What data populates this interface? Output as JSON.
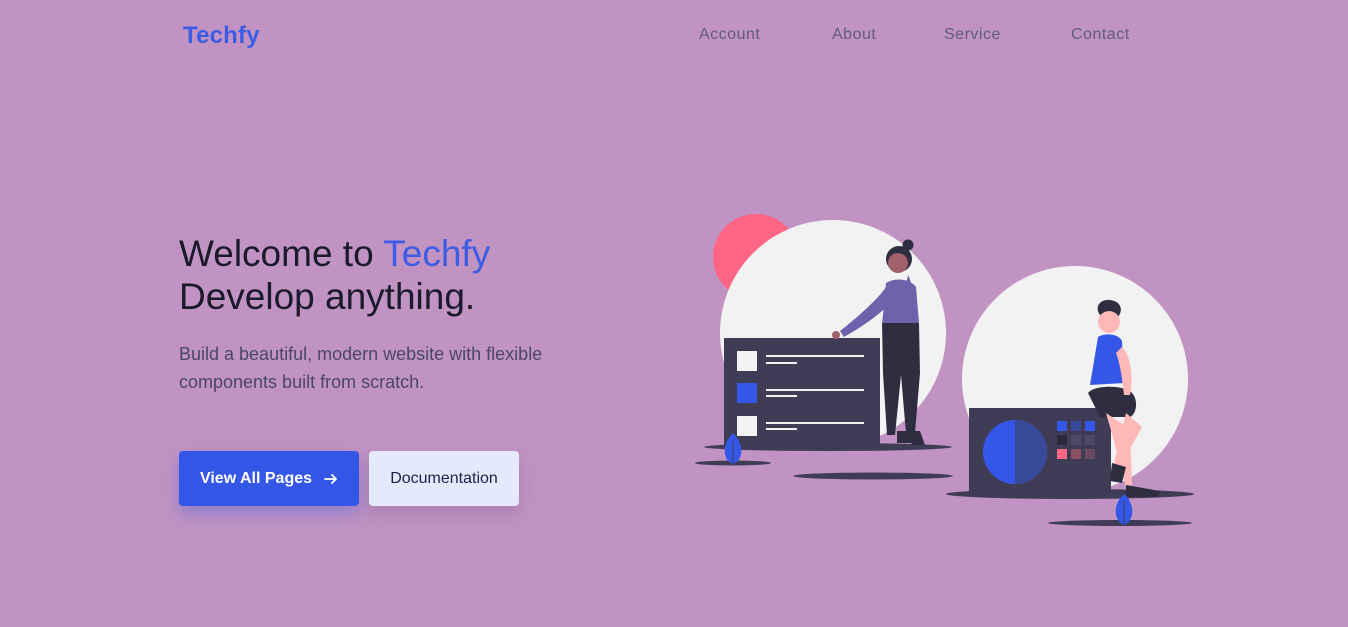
{
  "header": {
    "brand": "Techfy",
    "nav": [
      {
        "label": "Account"
      },
      {
        "label": "About"
      },
      {
        "label": "Service"
      },
      {
        "label": "Contact"
      }
    ]
  },
  "hero": {
    "title_prefix": "Welcome to ",
    "title_accent": "Techfy",
    "title_line2": "Develop anything.",
    "subtitle": "Build a beautiful, modern website with flexible components built from scratch.",
    "primary_button": "View All Pages",
    "primary_button_icon": "arrow-right-icon",
    "secondary_button": "Documentation"
  },
  "colors": {
    "background": "#c193c2",
    "accent": "#3d5ce6",
    "primary_button": "#3557e8",
    "secondary_button": "#e4e9fb",
    "illustration_dark": "#3f3d56",
    "illustration_pink": "#ff6584"
  }
}
